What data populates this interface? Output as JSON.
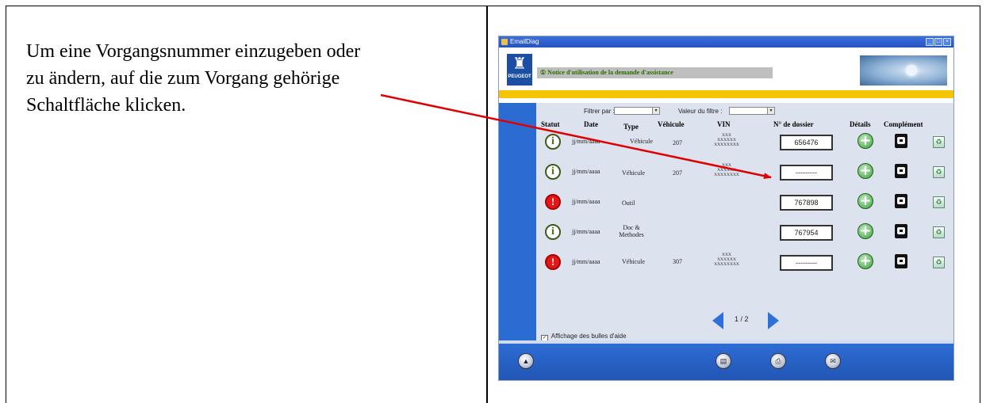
{
  "instruction": {
    "line1": "Um eine Vorgangsnummer einzugeben oder",
    "line2": "zu ändern, auf die zum Vorgang gehörige",
    "line3": "Schaltfläche klicken."
  },
  "app": {
    "window_title": "EmailDiag",
    "brand": "PEUGEOT",
    "notice_label": "Notice d'utilisation de la demande d'assistance",
    "filter": {
      "filter_by_label": "Filtrer par :",
      "filter_value_label": "Valeur du filtre :",
      "filter_by_value": "",
      "filter_value_value": ""
    },
    "columns": {
      "statut": "Statut",
      "date": "Date",
      "type": "Type",
      "vehicule": "Véhicule",
      "vin": "VIN",
      "dossier": "N° de dossier",
      "details": "Détails",
      "complement": "Complément"
    },
    "rows": [
      {
        "status": "info",
        "date": "jj/mm/aaaa",
        "type": "Véhicule",
        "vehicule": "207",
        "vin1": "XXX",
        "vin2": "XXXXXX",
        "vin3": "XXXXXXXX",
        "dossier": "656476"
      },
      {
        "status": "info",
        "date": "jj/mm/aaaa",
        "type": "Véhicule",
        "vehicule": "207",
        "vin1": "XXX",
        "vin2": "XXXXXX",
        "vin3": "XXXXXXXX",
        "dossier": "---------"
      },
      {
        "status": "warn",
        "date": "jj/mm/aaaa",
        "type": "Outil",
        "vehicule": "",
        "vin1": "",
        "vin2": "",
        "vin3": "",
        "dossier": "767898"
      },
      {
        "status": "info",
        "date": "jj/mm/aaaa",
        "type": "Doc &",
        "type2": "Methodes",
        "vehicule": "",
        "vin1": "",
        "vin2": "",
        "vin3": "",
        "dossier": "767954"
      },
      {
        "status": "warn",
        "date": "jj/mm/aaaa",
        "type": "Véhicule",
        "vehicule": "307",
        "vin1": "XXX",
        "vin2": "XXXXXX",
        "vin3": "XXXXXXXX",
        "dossier": "---------"
      }
    ],
    "pagination": "1 / 2",
    "help_bubbles_label": "Affichage des bulles d'aide",
    "help_bubbles_checked": true,
    "icons": {
      "status_info": "info-icon",
      "status_warn": "warning-icon",
      "details": "plus-icon",
      "complement": "camera-icon",
      "delete": "trash-icon"
    },
    "colors": {
      "blue": "#2b6cd3",
      "yellow": "#f5c400",
      "arrow": "#e00000"
    }
  }
}
